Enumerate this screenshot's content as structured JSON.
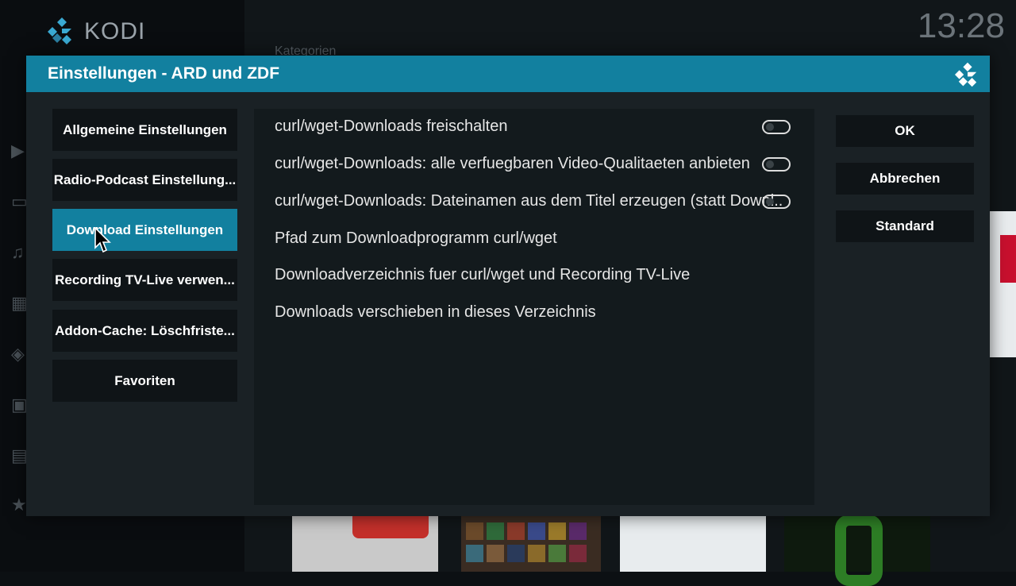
{
  "background": {
    "app_name": "KODI",
    "clock": "13:28",
    "category_label": "Kategorien"
  },
  "dialog": {
    "title": "Einstellungen - ARD und ZDF",
    "categories": [
      {
        "label": "Allgemeine Einstellungen",
        "active": false
      },
      {
        "label": "Radio-Podcast Einstellung...",
        "active": false
      },
      {
        "label": "Download Einstellungen",
        "active": true
      },
      {
        "label": "Recording TV-Live verwen...",
        "active": false
      },
      {
        "label": "Addon-Cache: Löschfriste...",
        "active": false
      },
      {
        "label": "Favoriten",
        "active": false
      }
    ],
    "settings": [
      {
        "label": "curl/wget-Downloads freischalten",
        "type": "toggle",
        "value": false
      },
      {
        "label": "curl/wget-Downloads: alle verfuegbaren Video-Qualitaeten anbieten",
        "type": "toggle",
        "value": false
      },
      {
        "label": "curl/wget-Downloads: Dateinamen aus dem Titel erzeugen (statt Downl...",
        "type": "toggle",
        "value": false
      },
      {
        "label": "Pfad zum Downloadprogramm curl/wget",
        "type": "action"
      },
      {
        "label": "Downloadverzeichnis fuer curl/wget und Recording TV-Live",
        "type": "action"
      },
      {
        "label": "Downloads verschieben in dieses Verzeichnis",
        "type": "action"
      }
    ],
    "buttons": {
      "ok": "OK",
      "cancel": "Abbrechen",
      "default": "Standard"
    }
  },
  "colors": {
    "accent": "#12809f",
    "dialog_bg": "#1a2125",
    "panel_bg": "#131a1d",
    "button_bg": "#0f1417"
  },
  "icons": [
    "kodi-logo-icon",
    "mouse-cursor-icon"
  ]
}
